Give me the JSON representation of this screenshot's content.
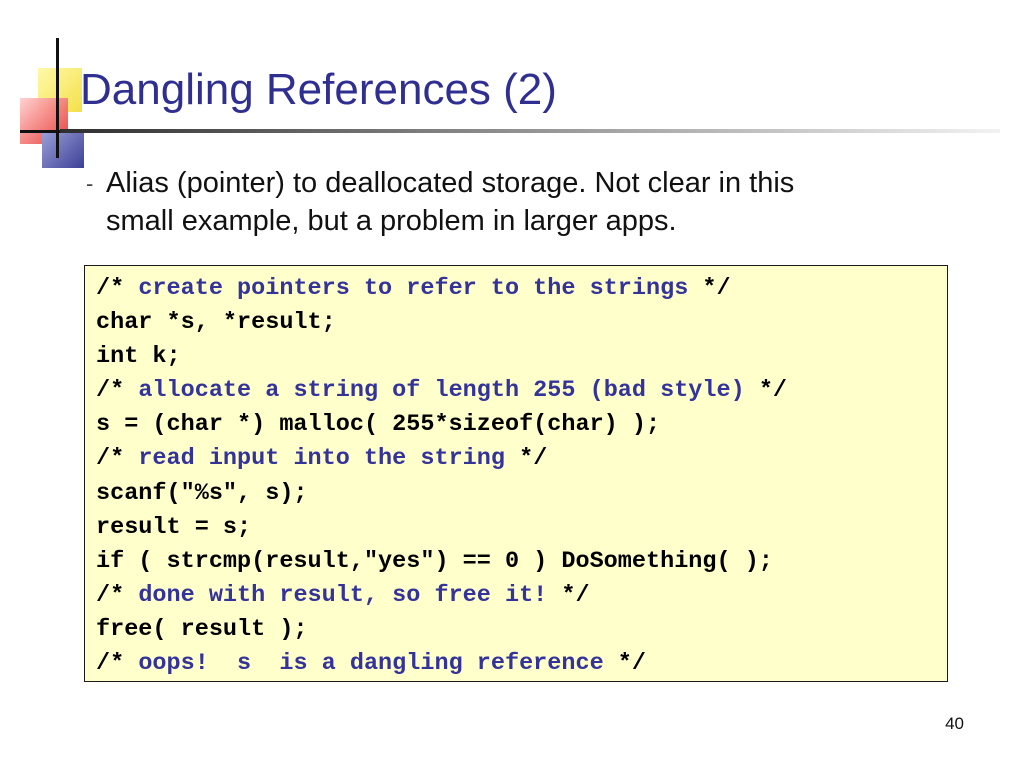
{
  "slide": {
    "title": "Dangling References (2)",
    "bullet": {
      "marker": "-",
      "line1": "Alias (pointer) to deallocated storage.  Not clear in this",
      "line2": "small example, but a problem in larger apps."
    },
    "code": [
      {
        "kind": "comment",
        "open": "/* ",
        "text": "create pointers to refer to the strings",
        "close": " */"
      },
      {
        "kind": "code",
        "text": "char *s, *result;"
      },
      {
        "kind": "code",
        "text": "int k;"
      },
      {
        "kind": "comment",
        "open": "/* ",
        "text": "allocate a string of length 255 (bad style)",
        "close": " */"
      },
      {
        "kind": "code",
        "text": "s = (char *) malloc( 255*sizeof(char) );"
      },
      {
        "kind": "comment",
        "open": "/* ",
        "text": "read input into the string",
        "close": " */"
      },
      {
        "kind": "code",
        "text": "scanf(\"%s\", s);"
      },
      {
        "kind": "code",
        "text": "result = s;"
      },
      {
        "kind": "code",
        "text": "if ( strcmp(result,\"yes\") == 0 ) DoSomething( );"
      },
      {
        "kind": "comment",
        "open": "/* ",
        "text": "done with result, so free it!",
        "close": " */"
      },
      {
        "kind": "code",
        "text": "free( result );"
      },
      {
        "kind": "comment",
        "open": "/* ",
        "text": "oops!  s  is a dangling reference",
        "close": " */"
      }
    ],
    "page_number": "40"
  },
  "colors": {
    "title": "#2f2f91",
    "comment": "#333399",
    "code_background": "#ffffcc"
  }
}
